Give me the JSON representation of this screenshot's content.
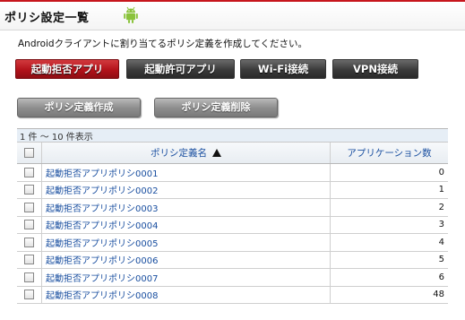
{
  "header": {
    "title": "ポリシ設定一覧"
  },
  "description": "Androidクライアントに割り当てるポリシ定義を作成してください。",
  "categories": [
    {
      "label": "起動拒否アプリ",
      "active": true
    },
    {
      "label": "起動許可アプリ",
      "active": false
    },
    {
      "label": "Wi-Fi接続",
      "active": false
    },
    {
      "label": "VPN接続",
      "active": false
    }
  ],
  "actions": {
    "create_label": "ポリシ定義作成",
    "delete_label": "ポリシ定義削除"
  },
  "table": {
    "count_text": "1 件 ～ 10 件表示",
    "headers": {
      "name": "ポリシ定義名",
      "count": "アプリケーション数"
    },
    "rows": [
      {
        "name": "起動拒否アプリポリシ0001",
        "count": "0"
      },
      {
        "name": "起動拒否アプリポリシ0002",
        "count": "1"
      },
      {
        "name": "起動拒否アプリポリシ0003",
        "count": "2"
      },
      {
        "name": "起動拒否アプリポリシ0004",
        "count": "3"
      },
      {
        "name": "起動拒否アプリポリシ0005",
        "count": "4"
      },
      {
        "name": "起動拒否アプリポリシ0006",
        "count": "5"
      },
      {
        "name": "起動拒否アプリポリシ0007",
        "count": "6"
      },
      {
        "name": "起動拒否アプリポリシ0008",
        "count": "48"
      }
    ]
  }
}
